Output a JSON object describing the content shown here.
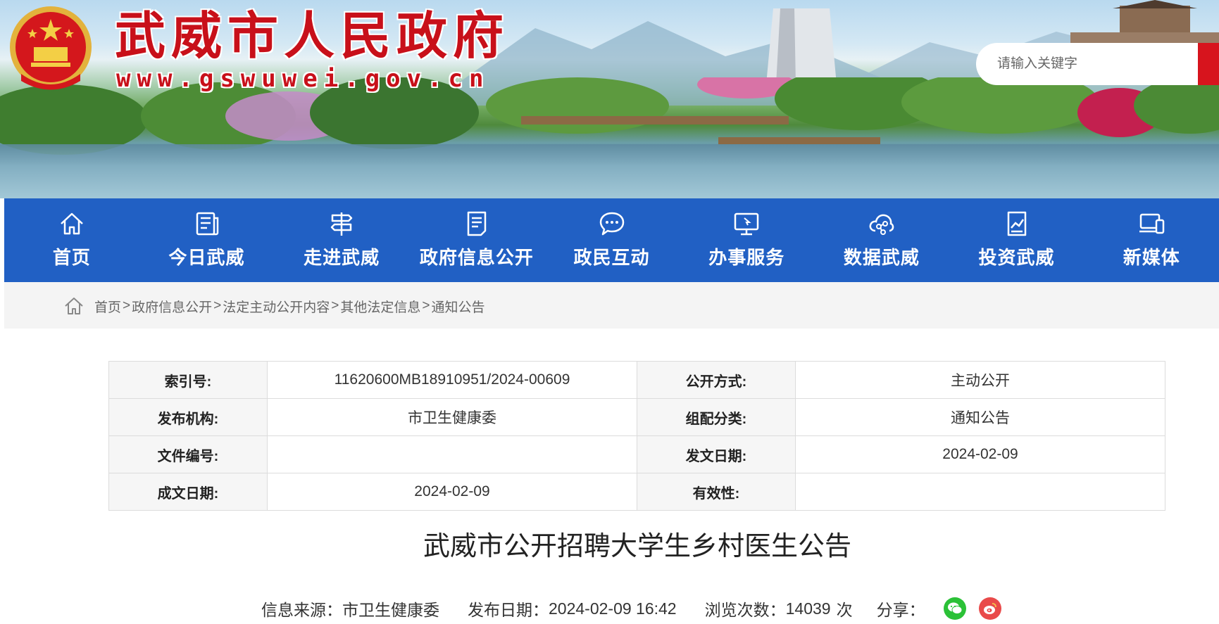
{
  "header": {
    "site_title": "武威市人民政府",
    "site_url": "www.gswuwei.gov.cn",
    "search_placeholder": "请输入关键字"
  },
  "nav": {
    "items": [
      {
        "label": "首页",
        "icon": "home-icon"
      },
      {
        "label": "今日武威",
        "icon": "news-icon"
      },
      {
        "label": "走进武威",
        "icon": "signpost-icon"
      },
      {
        "label": "政府信息公开",
        "icon": "document-icon"
      },
      {
        "label": "政民互动",
        "icon": "chat-icon"
      },
      {
        "label": "办事服务",
        "icon": "monitor-icon"
      },
      {
        "label": "数据武威",
        "icon": "cloud-data-icon"
      },
      {
        "label": "投资武威",
        "icon": "chart-icon"
      },
      {
        "label": "新媒体",
        "icon": "devices-icon"
      }
    ]
  },
  "breadcrumb": {
    "items": [
      "首页",
      "政府信息公开",
      "法定主动公开内容",
      "其他法定信息",
      "通知公告"
    ],
    "separator": ">"
  },
  "meta": {
    "rows": [
      {
        "k1": "索引号:",
        "v1": "11620600MB18910951/2024-00609",
        "k2": "公开方式:",
        "v2": "主动公开"
      },
      {
        "k1": "发布机构:",
        "v1": "市卫生健康委",
        "k2": "组配分类:",
        "v2": "通知公告"
      },
      {
        "k1": "文件编号:",
        "v1": "",
        "k2": "发文日期:",
        "v2": "2024-02-09"
      },
      {
        "k1": "成文日期:",
        "v1": "2024-02-09",
        "k2": "有效性:",
        "v2": ""
      }
    ]
  },
  "article": {
    "title": "武威市公开招聘大学生乡村医生公告",
    "source_label": "信息来源：",
    "source": "市卫生健康委",
    "date_label": "发布日期：",
    "date": "2024-02-09 16:42",
    "views_label": "浏览次数：",
    "views": "14039",
    "views_unit": "次",
    "share_label": "分享："
  },
  "colors": {
    "nav_bg": "#2160c4",
    "title_red": "#c8101a",
    "search_btn": "#d7141d"
  }
}
